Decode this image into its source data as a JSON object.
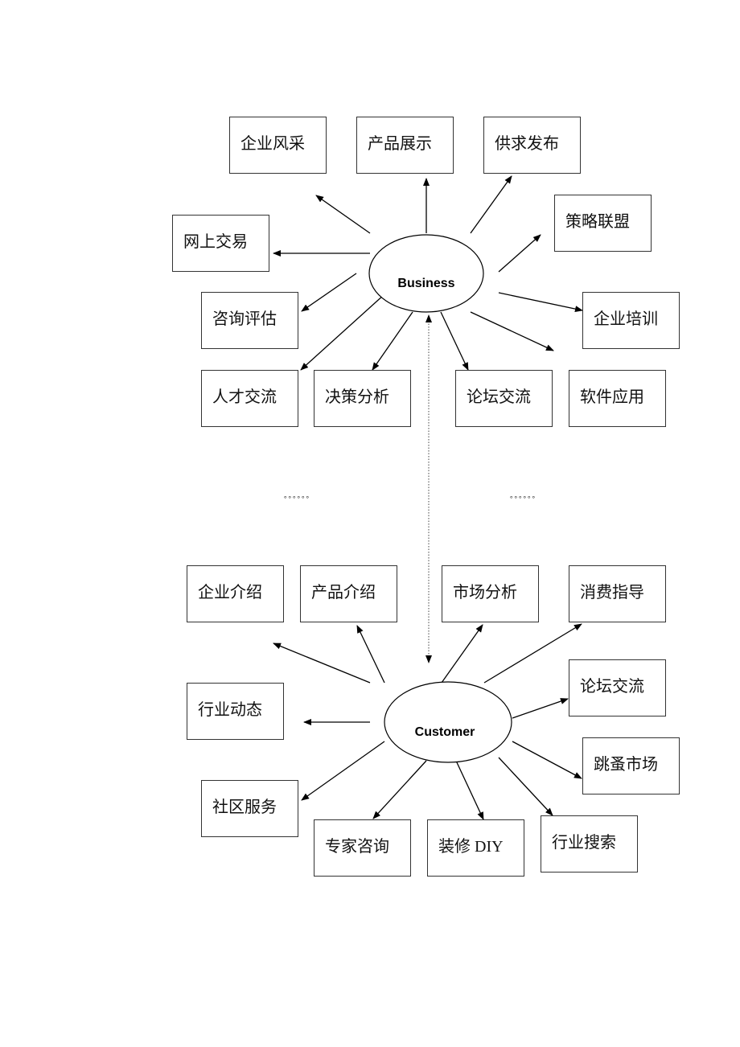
{
  "business": {
    "hub": "Business",
    "items": [
      "企业风采",
      "产品展示",
      "供求发布",
      "策略联盟",
      "网上交易",
      "咨询评估",
      "企业培训",
      "人才交流",
      "决策分析",
      "论坛交流",
      "软件应用"
    ]
  },
  "customer": {
    "hub": "Customer",
    "items": [
      "企业介绍",
      "产品介绍",
      "市场分析",
      "消费指导",
      "行业动态",
      "论坛交流",
      "跳蚤市场",
      "社区服务",
      "专家咨询",
      "装修 DIY",
      "行业搜索"
    ]
  },
  "ellipsis": "。。。。。。"
}
